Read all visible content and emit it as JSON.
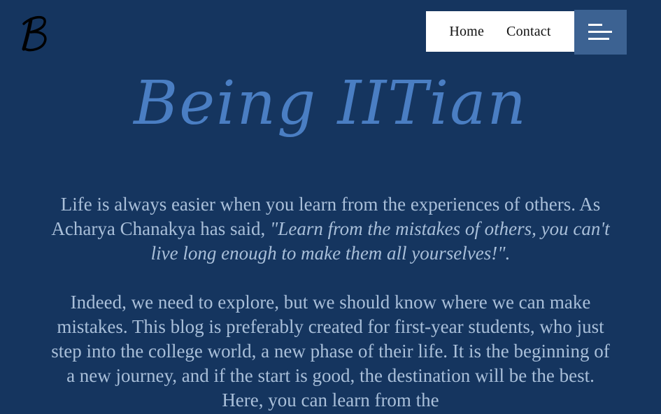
{
  "logo": {
    "icon": "script-b-logo-icon"
  },
  "nav": {
    "home_label": "Home",
    "contact_label": "Contact",
    "menu_icon": "hamburger-menu-icon"
  },
  "hero": {
    "title": "Being IITian"
  },
  "intro": {
    "text_before_quote": "Life is always easier when you learn from the experiences of others. As Acharya Chanakya has said, ",
    "quote": "\"Learn from the mistakes of others, you can't live long enough to make them all yourselves!\".",
    "body": "Indeed, we need to explore, but we should know where we can make mistakes. This blog is preferably created for first-year students, who just step into the college world, a new phase of their life. It is the beginning of a new journey, and if the start is good, the destination will be the best. Here, you can learn from the"
  },
  "colors": {
    "background": "#15355f",
    "title": "#4a7ec3",
    "body_text": "#a9bfd9",
    "menu_button": "#3c6292",
    "nav_box": "#ffffff"
  }
}
